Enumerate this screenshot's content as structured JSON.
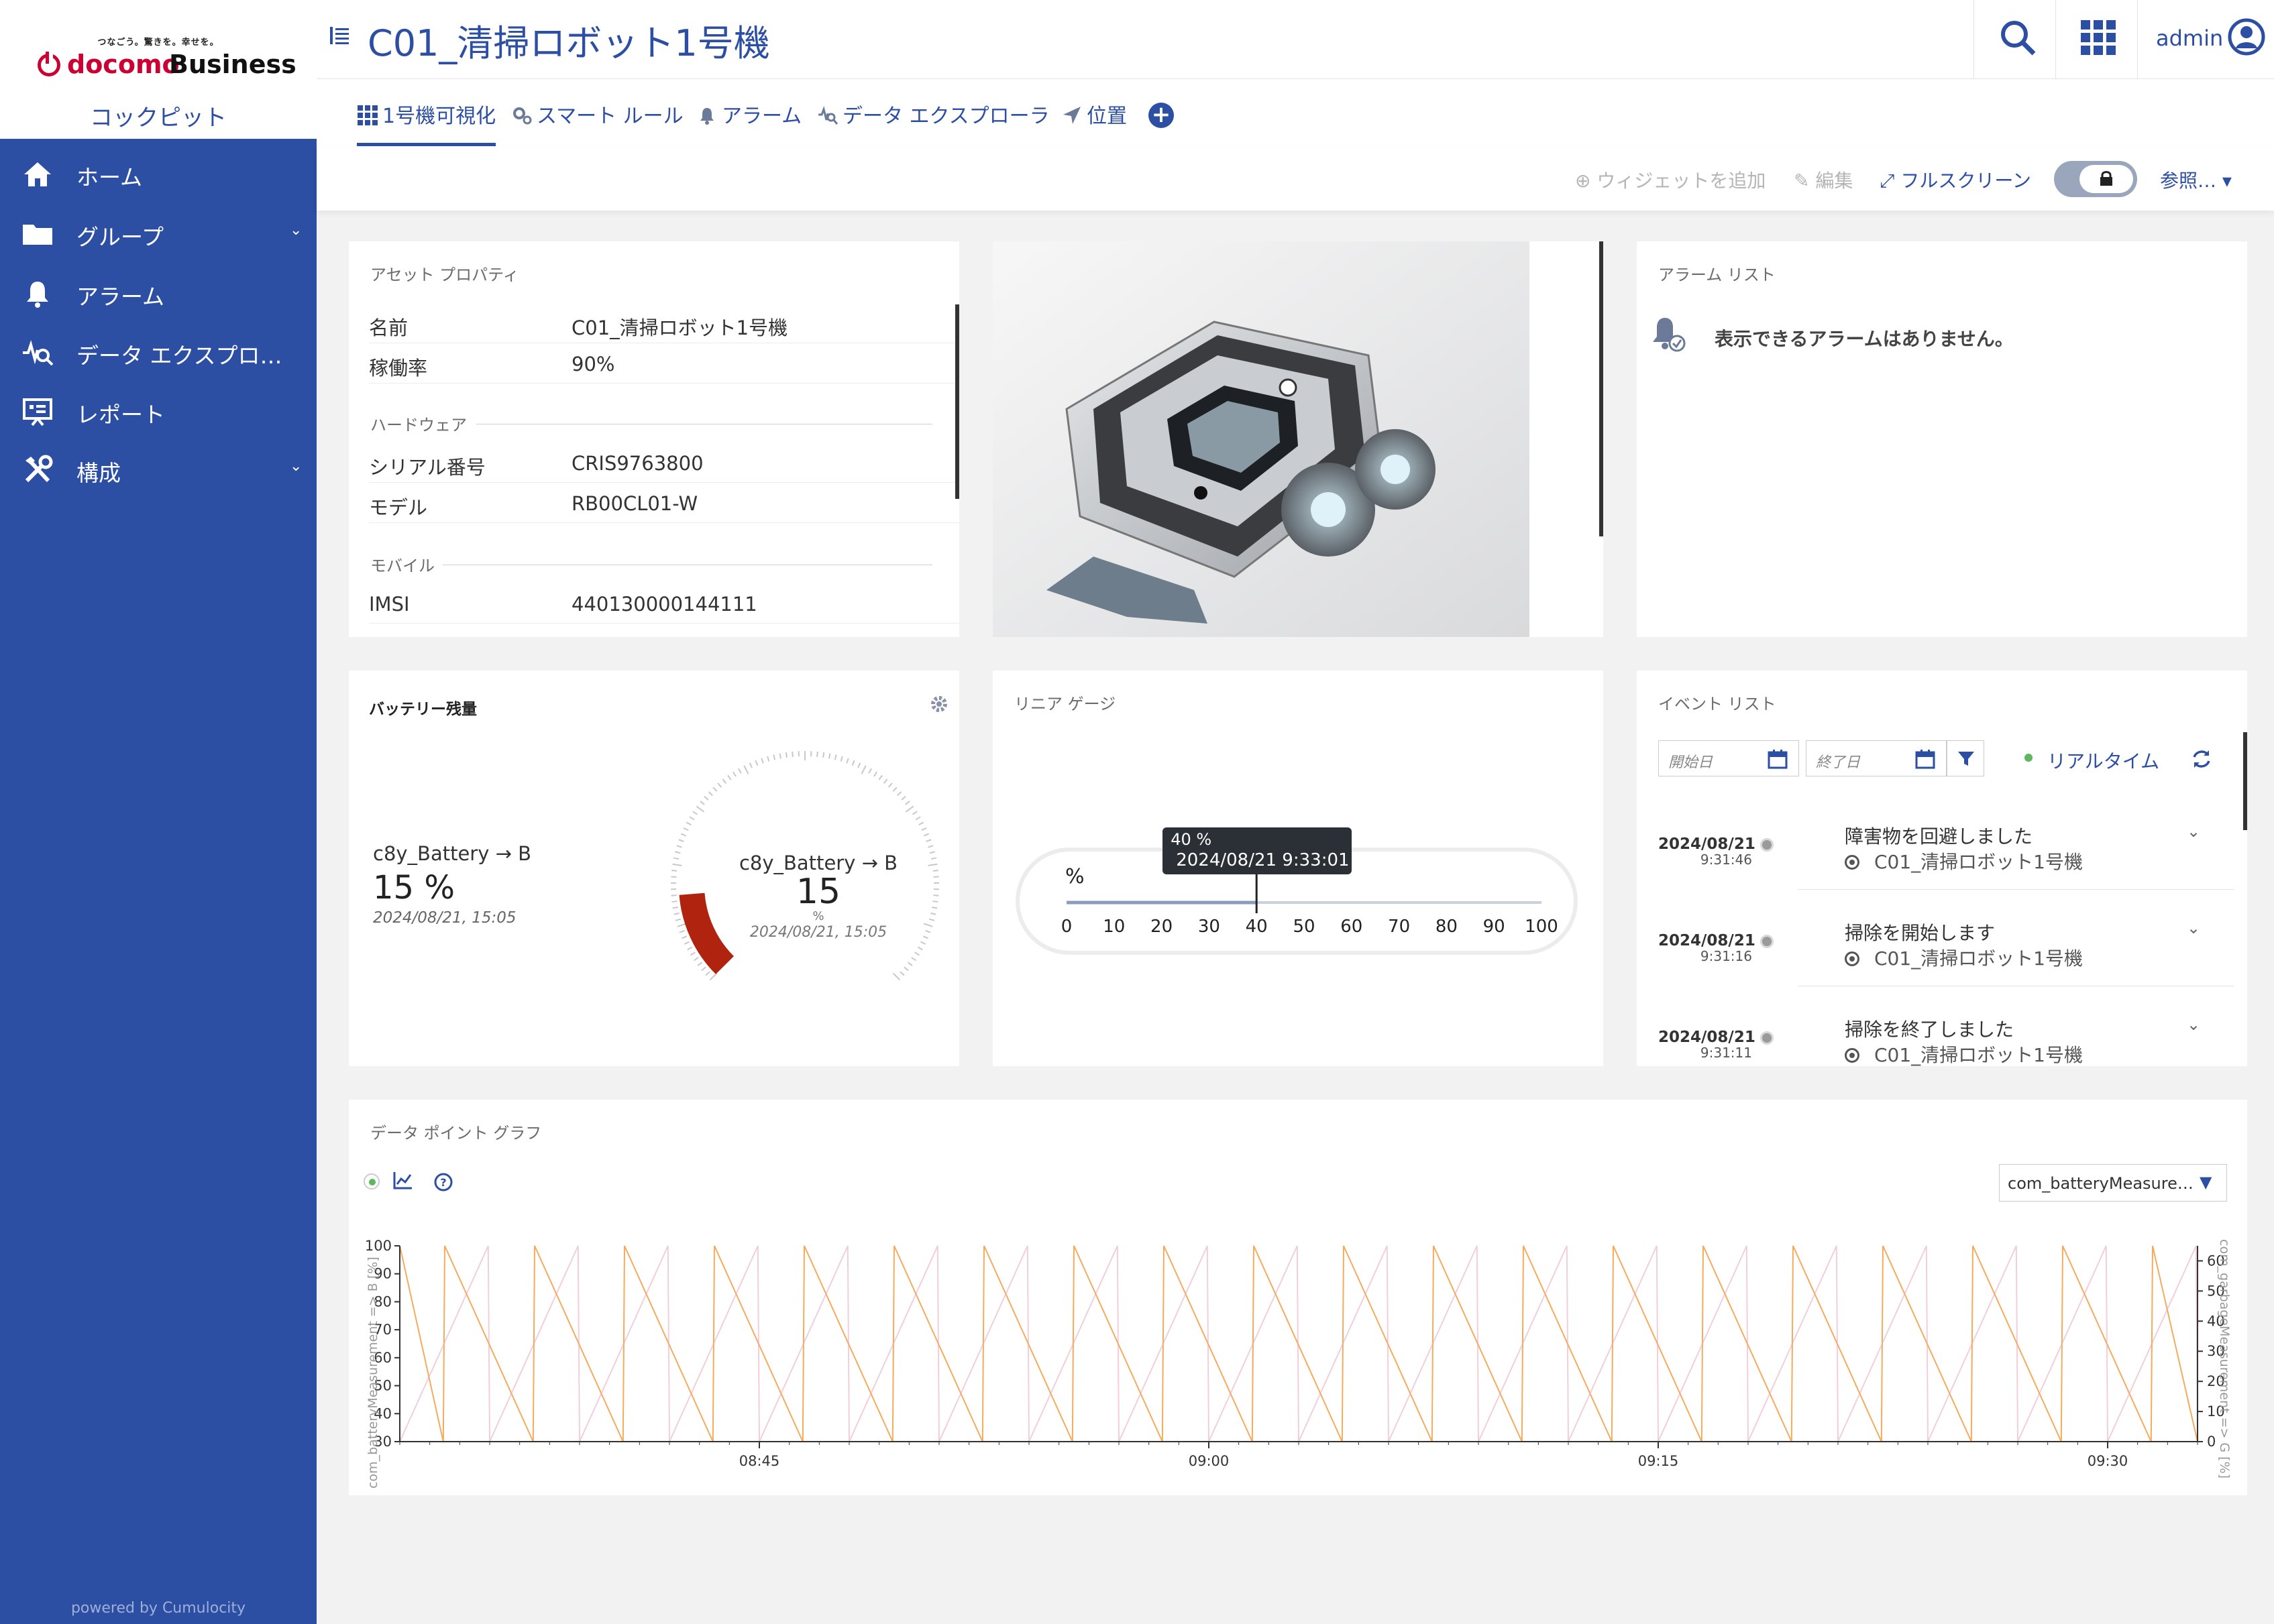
{
  "brand": {
    "tagline": "つなごう。驚きを。幸せを。",
    "logo_part1": "docomo",
    "logo_part2": "Business",
    "app_name": "コックピット",
    "powered_by": "powered by Cumulocity"
  },
  "sidebar": {
    "items": [
      {
        "label": "ホーム",
        "icon": "home-icon"
      },
      {
        "label": "グループ",
        "icon": "folder-icon",
        "expandable": true
      },
      {
        "label": "アラーム",
        "icon": "bell-icon"
      },
      {
        "label": "データ エクスプロ…",
        "icon": "data-explorer-icon"
      },
      {
        "label": "レポート",
        "icon": "report-icon"
      },
      {
        "label": "構成",
        "icon": "wrench-icon",
        "expandable": true
      }
    ]
  },
  "header": {
    "title": "C01_清掃ロボット1号機",
    "user": "admin"
  },
  "tabs": [
    {
      "label": "1号機可視化",
      "icon": "grid-icon",
      "active": true
    },
    {
      "label": "スマート ルール",
      "icon": "gears-icon"
    },
    {
      "label": "アラーム",
      "icon": "bell-icon"
    },
    {
      "label": "データ エクスプローラ",
      "icon": "data-explorer-icon"
    },
    {
      "label": "位置",
      "icon": "location-arrow-icon"
    }
  ],
  "actions": {
    "add_widget": "ウィジェットを追加",
    "edit": "編集",
    "fullscreen": "フルスクリーン",
    "reference": "参照…"
  },
  "asset": {
    "title": "アセット プロパティ",
    "rows_top": [
      {
        "key": "名前",
        "value": "C01_清掃ロボット1号機"
      },
      {
        "key": "稼働率",
        "value": "90%"
      }
    ],
    "section_hw": "ハードウェア",
    "rows_hw": [
      {
        "key": "シリアル番号",
        "value": "CRIS9763800"
      },
      {
        "key": "モデル",
        "value": "RB00CL01-W"
      }
    ],
    "section_mobile": "モバイル",
    "rows_mobile": [
      {
        "key": "IMSI",
        "value": "440130000144111"
      }
    ]
  },
  "alarms": {
    "title": "アラーム リスト",
    "empty": "表示できるアラームはありません。"
  },
  "battery": {
    "title": "バッテリー残量",
    "label": "c8y_Battery → B",
    "value_text": "15 %",
    "timestamp": "2024/08/21, 15:05",
    "gauge_label": "c8y_Battery → B",
    "gauge_value": "15",
    "gauge_unit": "%",
    "gauge_timestamp": "2024/08/21, 15:05",
    "level": 15,
    "color": "#b0240f"
  },
  "linear_gauge": {
    "title": "リニア ゲージ",
    "unit": "%",
    "ticks": [
      "0",
      "10",
      "20",
      "30",
      "40",
      "50",
      "60",
      "70",
      "80",
      "90",
      "100"
    ],
    "value": 40,
    "tooltip_value": "40 %",
    "tooltip_time": "2024/08/21 9:33:01"
  },
  "events": {
    "title": "イベント リスト",
    "start_placeholder": "開始日",
    "end_placeholder": "終了日",
    "realtime": "リアルタイム",
    "items": [
      {
        "date": "2024/08/21",
        "time": "9:31:46",
        "text": "障害物を回避しました",
        "source": "C01_清掃ロボット1号機"
      },
      {
        "date": "2024/08/21",
        "time": "9:31:16",
        "text": "掃除を開始します",
        "source": "C01_清掃ロボット1号機"
      },
      {
        "date": "2024/08/21",
        "time": "9:31:11",
        "text": "掃除を終了しました",
        "source": "C01_清掃ロボット1号機"
      }
    ]
  },
  "graph": {
    "title": "データ ポイント グラフ",
    "selector": "com_batteryMeasure…"
  },
  "chart_data": {
    "type": "line",
    "title": "",
    "x_ticks": [
      "08:45",
      "09:00",
      "09:15",
      "09:30"
    ],
    "xlim": [
      "08:33",
      "09:33"
    ],
    "y_left": {
      "label": "com_batteryMeasurement => B [%]",
      "ticks": [
        30,
        40,
        50,
        60,
        70,
        80,
        90,
        100
      ],
      "lim": [
        30,
        100
      ]
    },
    "y_right": {
      "label": "com_garbageMeasurement => G [%]",
      "ticks": [
        0,
        10,
        20,
        30,
        40,
        50,
        60
      ],
      "lim": [
        0,
        65
      ]
    },
    "series": [
      {
        "axis": "left",
        "color": "#f4a24a",
        "pattern": "sawtooth-up",
        "min": 30,
        "max": 100,
        "period_minutes": 3
      },
      {
        "axis": "right",
        "color": "#e8a8b8",
        "pattern": "sawtooth-down",
        "min": 0,
        "max": 65,
        "period_minutes": 3
      }
    ]
  }
}
